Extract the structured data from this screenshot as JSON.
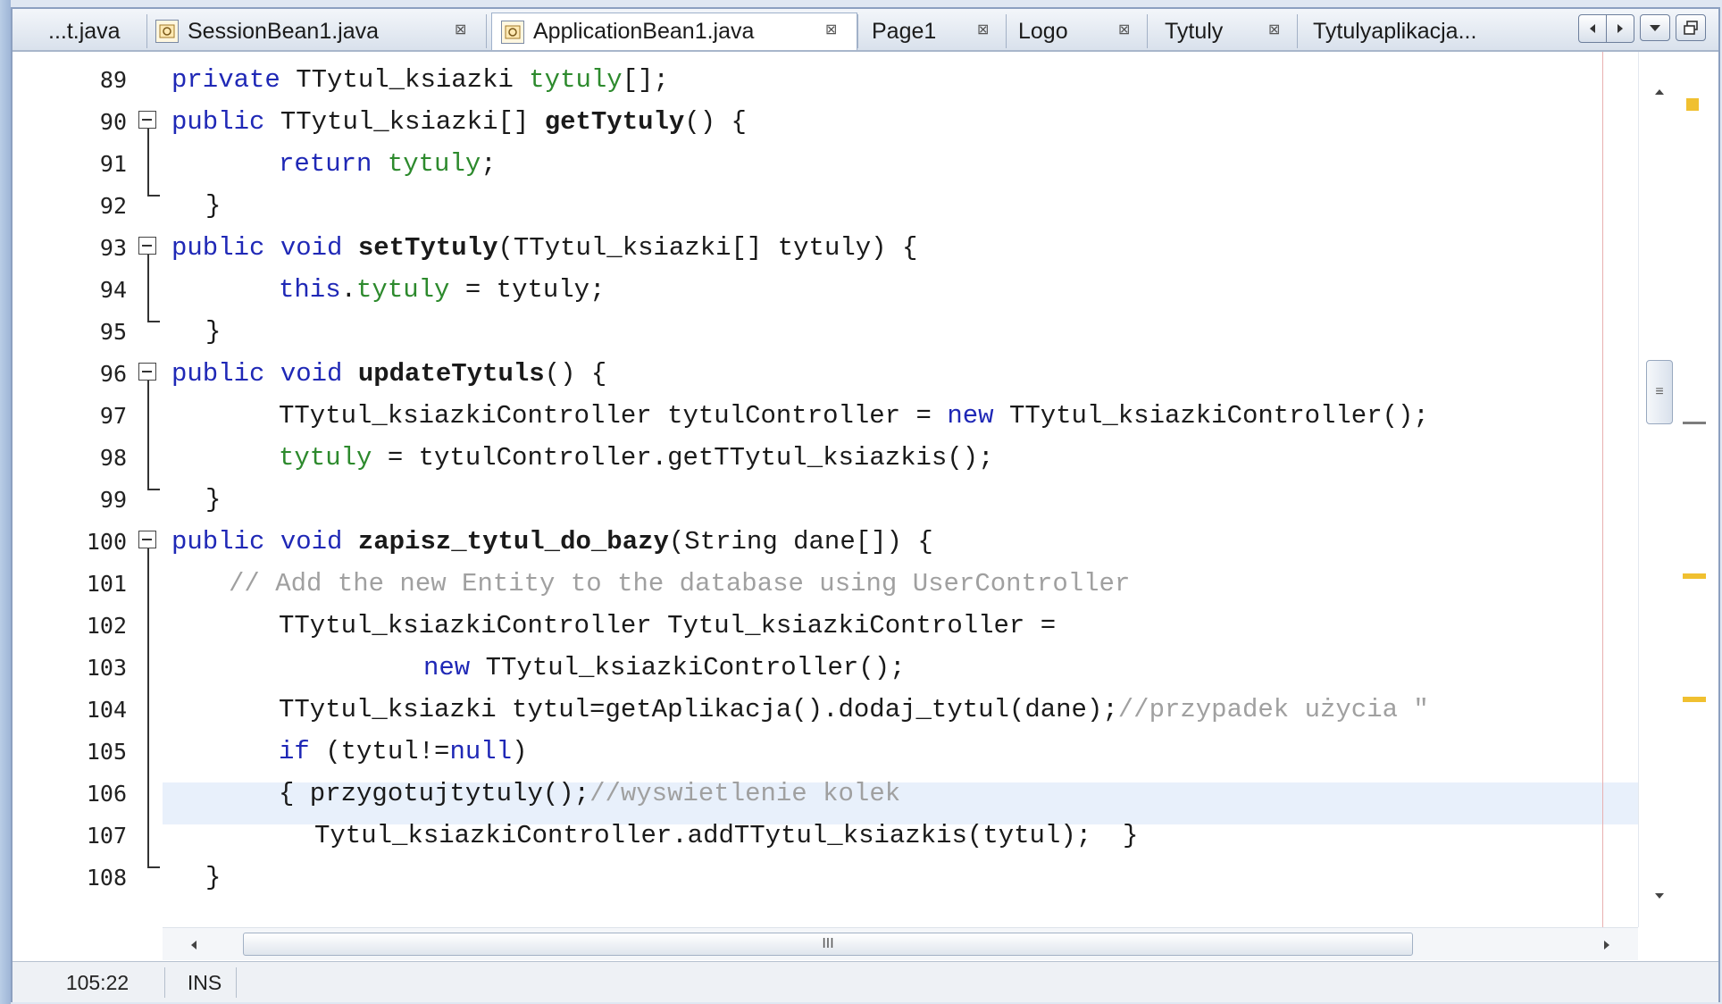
{
  "tabs": [
    {
      "label": "...t.java",
      "close": ""
    },
    {
      "label": "SessionBean1.java",
      "close": "⊠"
    },
    {
      "label": "ApplicationBean1.java",
      "close": "⊠",
      "active": true
    },
    {
      "label": "Page1",
      "close": "⊠"
    },
    {
      "label": "Logo",
      "close": "⊠"
    },
    {
      "label": "Tytuly",
      "close": "⊠"
    },
    {
      "label": "Tytulyaplikacja...",
      "close": ""
    }
  ],
  "lines": [
    {
      "n": "89"
    },
    {
      "n": "90"
    },
    {
      "n": "91"
    },
    {
      "n": "92"
    },
    {
      "n": "93"
    },
    {
      "n": "94"
    },
    {
      "n": "95"
    },
    {
      "n": "96"
    },
    {
      "n": "97"
    },
    {
      "n": "98"
    },
    {
      "n": "99"
    },
    {
      "n": "100"
    },
    {
      "n": "101"
    },
    {
      "n": "102"
    },
    {
      "n": "103"
    },
    {
      "n": "104"
    },
    {
      "n": "105"
    },
    {
      "n": "106"
    },
    {
      "n": "107"
    },
    {
      "n": "108"
    }
  ],
  "code": {
    "l89": {
      "a": "private ",
      "b": "TTytul_ksiazki ",
      "c": "tytuly",
      "d": "[];"
    },
    "l90": {
      "a": "public ",
      "b": "TTytul_ksiazki[] ",
      "c": "getTytuly",
      "d": "() {"
    },
    "l91": {
      "a": "return ",
      "b": "tytuly",
      "c": ";"
    },
    "l92": {
      "a": "}"
    },
    "l93": {
      "a": "public void ",
      "b": "setTytuly",
      "c": "(TTytul_ksiazki[] tytuly) {"
    },
    "l94": {
      "a": "this",
      "b": ".",
      "c": "tytuly",
      "d": " = tytuly;"
    },
    "l95": {
      "a": "}"
    },
    "l96": {
      "a": "public void ",
      "b": "updateTytuls",
      "c": "() {"
    },
    "l97": {
      "a": "TTytul_ksiazkiController tytulController = ",
      "b": "new",
      "c": " TTytul_ksiazkiController();"
    },
    "l98": {
      "a": "tytuly",
      "b": " = tytulController.getTTytul_ksiazkis();"
    },
    "l99": {
      "a": "}"
    },
    "l100": {
      "a": "public void ",
      "b": "zapisz_tytul_do_bazy",
      "c": "(String dane[]) {"
    },
    "l101": {
      "a": "// Add the new Entity to the database using UserController"
    },
    "l102": {
      "a": "TTytul_ksiazkiController Tytul_ksiazkiController ="
    },
    "l103": {
      "a": "new",
      "b": " TTytul_ksiazkiController();"
    },
    "l104": {
      "a": "TTytul_ksiazki tytul=getAplikacja().dodaj_tytul(dane);",
      "b": "//przypadek użycia \""
    },
    "l105": {
      "a": "if",
      "b": " (tytul!=",
      "c": "null",
      "d": ")"
    },
    "l106": {
      "a": "{ przygotujtytuly();",
      "b": "//wyswietlenie kolek"
    },
    "l107": {
      "a": "Tytul_ksiazkiController.addTTytul_ksiazkis(tytul);  }"
    },
    "l108": {
      "a": "}"
    }
  },
  "hscroll": {
    "grip": "III"
  },
  "vscroll": {
    "grip": "≡"
  },
  "status": {
    "position": "105:22",
    "mode": "INS"
  },
  "colors": {
    "keyword": "#1f28b6",
    "field": "#2d8a2d",
    "comment": "#a0a0a0",
    "current_line": "#e8f0fb",
    "mark": "#f0c030"
  }
}
